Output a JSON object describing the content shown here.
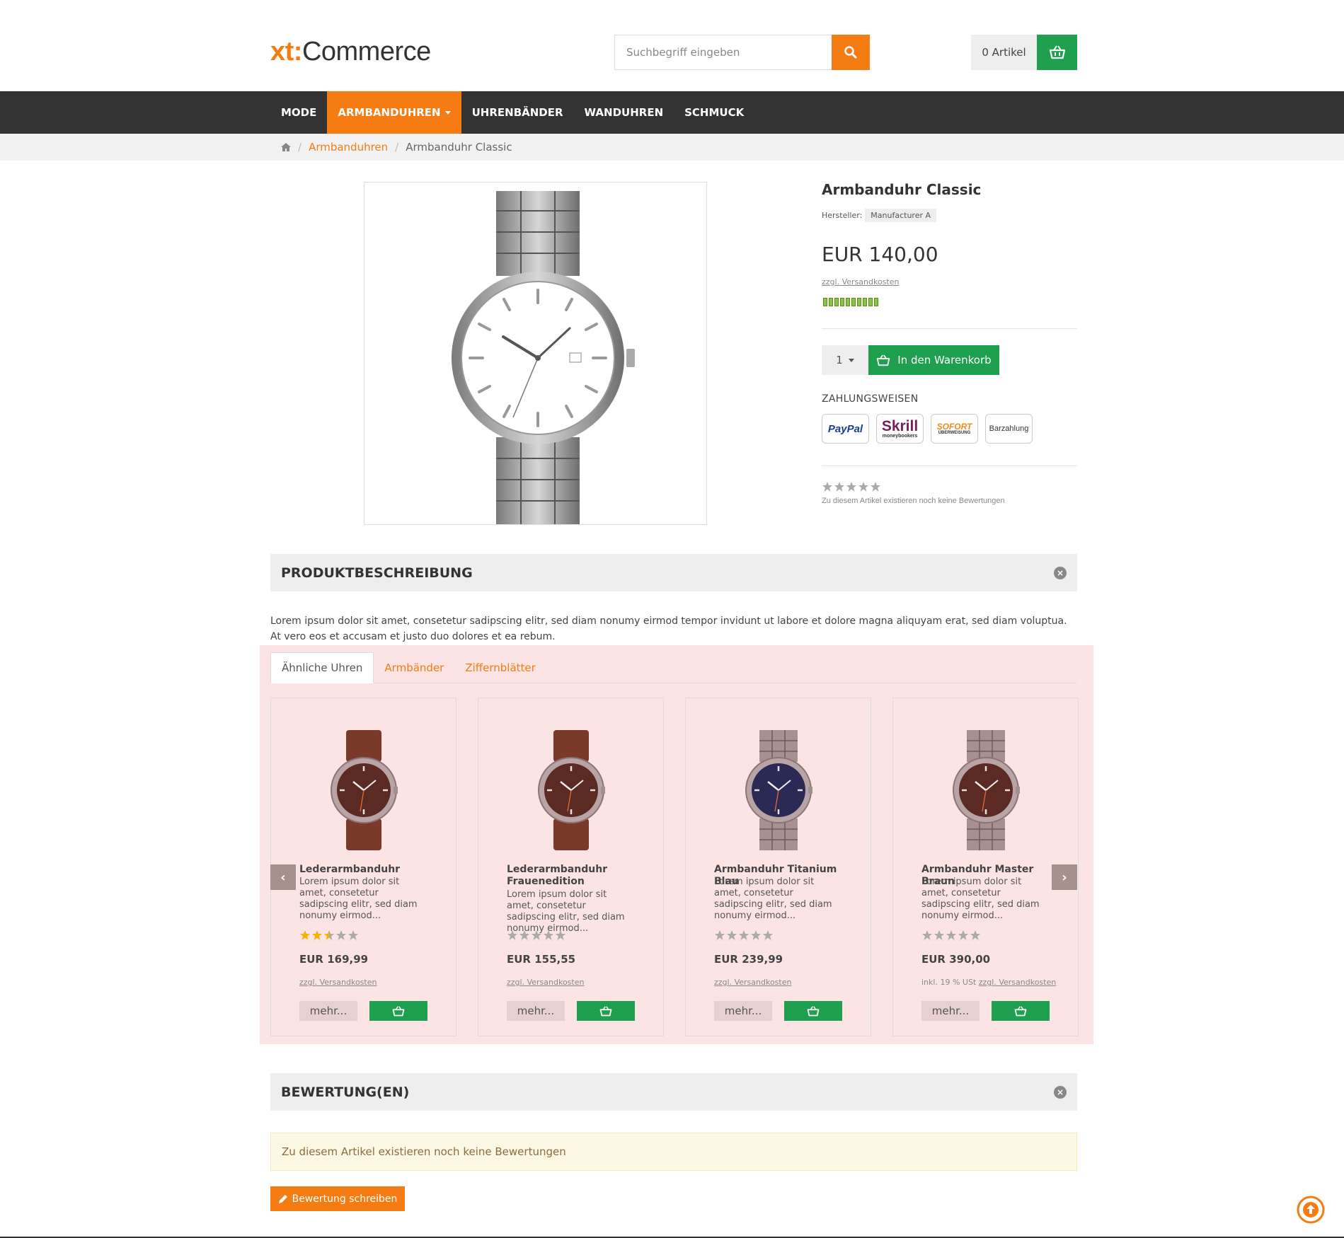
{
  "header": {
    "logo_left": "xt:",
    "logo_right": "Commerce",
    "search_placeholder": "Suchbegriff eingeben",
    "cart_count": "0 Artikel"
  },
  "nav": {
    "items": [
      "MODE",
      "ARMBANDUHREN",
      "UHRENBÄNDER",
      "WANDUHREN",
      "SCHMUCK"
    ],
    "active": "ARMBANDUHREN"
  },
  "breadcrumb": {
    "items": [
      "Armbanduhren",
      "Armbanduhr Classic"
    ]
  },
  "product": {
    "title": "Armbanduhr Classic",
    "manufacturer_label": "Hersteller:",
    "manufacturer": "Manufacturer A",
    "price": "EUR 140,00",
    "shipping": "zzgl. Versandkosten",
    "quantity": "1",
    "add_to_cart": "In den Warenkorb",
    "payment_heading": "ZAHLUNGSWEISEN",
    "payments": [
      "PayPal",
      "Skrill",
      "SOFORT",
      "Barzahlung"
    ],
    "payment_sublabels": [
      "moneybookers",
      "ÜBERWEISUNG"
    ],
    "rating": 0,
    "no_reviews": "Zu diesem Artikel existieren noch keine Bewertungen"
  },
  "description": {
    "heading": "PRODUKTBESCHREIBUNG",
    "text": "Lorem ipsum dolor sit amet, consetetur sadipscing elitr, sed diam nonumy eirmod tempor invidunt ut labore et dolore magna aliquyam erat, sed diam voluptua. At vero eos et accusam et justo duo dolores et ea rebum."
  },
  "tabs": {
    "items": [
      "Ähnliche Uhren",
      "Armbänder",
      "Ziffernblätter"
    ],
    "active": "Ähnliche Uhren"
  },
  "cards": [
    {
      "name": "Lederarmbanduhr",
      "text": "Lorem ipsum dolor sit amet, consetetur sadipscing elitr, sed diam nonumy eirmod...",
      "rating": 2.5,
      "price": "EUR 169,99",
      "tax": "",
      "shipping": "zzgl. Versandkosten",
      "more": "mehr...",
      "dial": "#5a2a23",
      "strap": "leather"
    },
    {
      "name": "Lederarmbanduhr Frauenedition",
      "text": "Lorem ipsum dolor sit amet, consetetur sadipscing elitr, sed diam nonumy eirmod...",
      "rating": 0,
      "price": "EUR 155,55",
      "tax": "",
      "shipping": "zzgl. Versandkosten",
      "more": "mehr...",
      "dial": "#5a2a23",
      "strap": "leather"
    },
    {
      "name": "Armbanduhr Titanium Blau",
      "text": "Lorem ipsum dolor sit amet, consetetur sadipscing elitr, sed diam nonumy eirmod...",
      "rating": 0,
      "price": "EUR 239,99",
      "tax": "",
      "shipping": "zzgl. Versandkosten",
      "more": "mehr...",
      "dial": "#2a2a55",
      "strap": "metal"
    },
    {
      "name": "Armbanduhr Master Braun",
      "text": "Lorem ipsum dolor sit amet, consetetur sadipscing elitr, sed diam nonumy eirmod...",
      "rating": 0,
      "price": "EUR 390,00",
      "tax": "inkl. 19 % USt",
      "shipping": "zzgl. Versandkosten",
      "more": "mehr...",
      "dial": "#5a2a23",
      "strap": "metal"
    }
  ],
  "reviews": {
    "heading": "BEWERTUNG(EN)",
    "notice": "Zu diesem Artikel existieren noch keine Bewertungen",
    "write_button": "Bewertung schreiben"
  },
  "colors": {
    "accent": "#f47c13",
    "green": "#1fa04f",
    "nav_bg": "#333333",
    "highlight": "#fce4e4"
  }
}
